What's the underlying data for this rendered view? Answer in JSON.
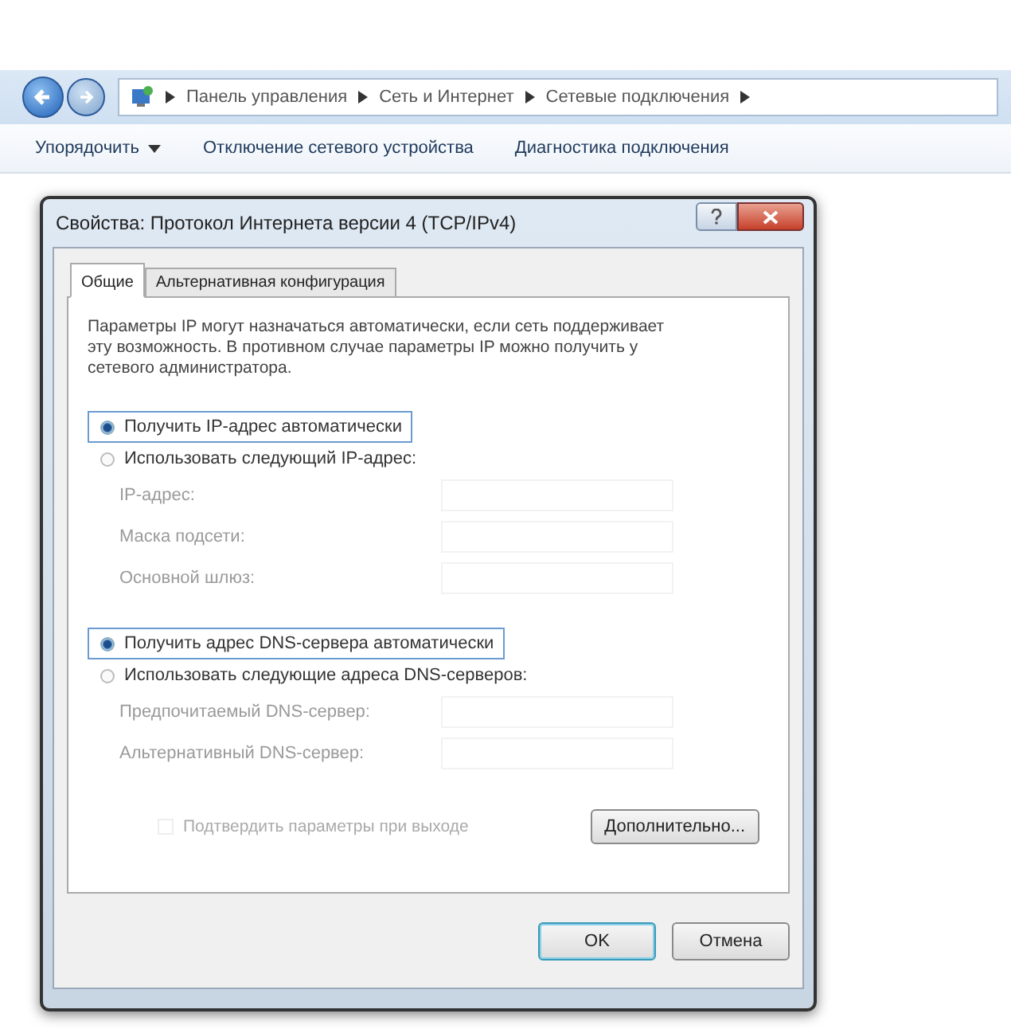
{
  "nav": {
    "breadcrumb": [
      "Панель управления",
      "Сеть и Интернет",
      "Сетевые подключения"
    ]
  },
  "toolbar": [
    {
      "label": "Упорядочить",
      "kind": "menu"
    },
    {
      "label": "Отключение сетевого устройства",
      "kind": "button"
    },
    {
      "label": "Диагностика подключения",
      "kind": "button"
    }
  ],
  "dialog": {
    "title": "Свойства: Протокол Интернета версии 4 (TCP/IPv4)",
    "tabs": [
      {
        "label": "Общие",
        "selected": true
      },
      {
        "label": "Альтернативная конфигурация",
        "selected": false
      }
    ],
    "description": "Параметры IP могут назначаться автоматически, если сеть поддерживает эту возможность. В противном случае параметры IP можно получить у сетевого администратора.",
    "ip_options": [
      {
        "label": "Получить IP-адрес автоматически",
        "selected": true,
        "focused": true
      },
      {
        "label": "Использовать следующий IP-адрес:",
        "selected": false,
        "focused": false
      }
    ],
    "ip_fields": [
      {
        "label": "IP-адрес:",
        "disabled": true
      },
      {
        "label": "Маска подсети:",
        "disabled": true
      },
      {
        "label": "Основной шлюз:",
        "disabled": true
      }
    ],
    "dns_options": [
      {
        "label": "Получить адрес DNS-сервера автоматически",
        "selected": true,
        "focused": true
      },
      {
        "label": "Использовать следующие адреса DNS-серверов:",
        "selected": false,
        "focused": false
      }
    ],
    "dns_fields": [
      {
        "label": "Предпочитаемый DNS-сервер:",
        "disabled": true
      },
      {
        "label": "Альтернативный DNS-сервер:",
        "disabled": true
      }
    ],
    "validate": {
      "label": "Подтвердить параметры при выходе",
      "checked": false,
      "disabled": true
    },
    "advanced_button": "Дополнительно...",
    "buttons": [
      {
        "label": "OK",
        "default": true
      },
      {
        "label": "Отмена",
        "default": false
      }
    ]
  }
}
